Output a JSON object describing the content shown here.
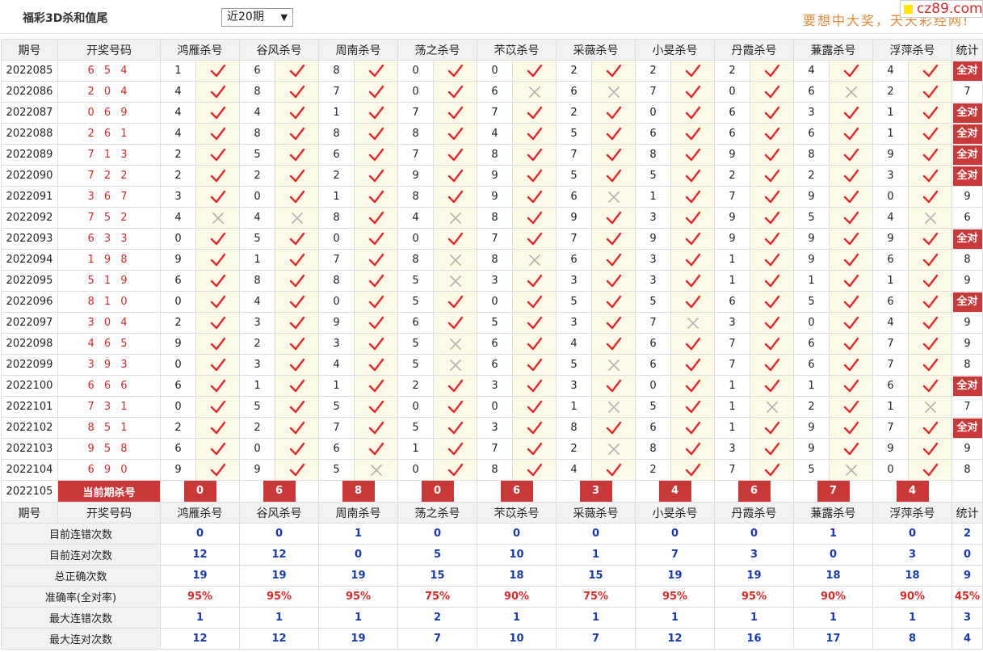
{
  "header": {
    "title": "福彩3D杀和值尾",
    "range_select": "近20期",
    "slogan": "要想中大奖，天天彩经网!",
    "logo_text": "cz89.com"
  },
  "columns": [
    "期号",
    "开奖号码",
    "鸿雁杀号",
    "谷风杀号",
    "周南杀号",
    "荡之杀号",
    "芣苡杀号",
    "采薇杀号",
    "小旻杀号",
    "丹霞杀号",
    "蒹露杀号",
    "浮萍杀号",
    "统计"
  ],
  "rows": [
    {
      "period": "2022085",
      "draw": "6 5 4",
      "kills": [
        [
          "1",
          "y"
        ],
        [
          "6",
          "y"
        ],
        [
          "8",
          "y"
        ],
        [
          "0",
          "y"
        ],
        [
          "0",
          "y"
        ],
        [
          "2",
          "y"
        ],
        [
          "2",
          "y"
        ],
        [
          "2",
          "y"
        ],
        [
          "4",
          "y"
        ],
        [
          "4",
          "y"
        ]
      ],
      "stat": "全对"
    },
    {
      "period": "2022086",
      "draw": "2 0 4",
      "kills": [
        [
          "4",
          "y"
        ],
        [
          "8",
          "y"
        ],
        [
          "7",
          "y"
        ],
        [
          "0",
          "y"
        ],
        [
          "6",
          "n"
        ],
        [
          "6",
          "n"
        ],
        [
          "7",
          "y"
        ],
        [
          "0",
          "y"
        ],
        [
          "6",
          "n"
        ],
        [
          "2",
          "y"
        ]
      ],
      "stat": "7"
    },
    {
      "period": "2022087",
      "draw": "0 6 9",
      "kills": [
        [
          "4",
          "y"
        ],
        [
          "4",
          "y"
        ],
        [
          "1",
          "y"
        ],
        [
          "7",
          "y"
        ],
        [
          "7",
          "y"
        ],
        [
          "2",
          "y"
        ],
        [
          "0",
          "y"
        ],
        [
          "6",
          "y"
        ],
        [
          "3",
          "y"
        ],
        [
          "1",
          "y"
        ]
      ],
      "stat": "全对"
    },
    {
      "period": "2022088",
      "draw": "2 6 1",
      "kills": [
        [
          "4",
          "y"
        ],
        [
          "8",
          "y"
        ],
        [
          "8",
          "y"
        ],
        [
          "8",
          "y"
        ],
        [
          "4",
          "y"
        ],
        [
          "5",
          "y"
        ],
        [
          "6",
          "y"
        ],
        [
          "6",
          "y"
        ],
        [
          "6",
          "y"
        ],
        [
          "1",
          "y"
        ]
      ],
      "stat": "全对"
    },
    {
      "period": "2022089",
      "draw": "7 1 3",
      "kills": [
        [
          "2",
          "y"
        ],
        [
          "5",
          "y"
        ],
        [
          "6",
          "y"
        ],
        [
          "7",
          "y"
        ],
        [
          "8",
          "y"
        ],
        [
          "7",
          "y"
        ],
        [
          "8",
          "y"
        ],
        [
          "9",
          "y"
        ],
        [
          "8",
          "y"
        ],
        [
          "9",
          "y"
        ]
      ],
      "stat": "全对"
    },
    {
      "period": "2022090",
      "draw": "7 2 2",
      "kills": [
        [
          "2",
          "y"
        ],
        [
          "2",
          "y"
        ],
        [
          "2",
          "y"
        ],
        [
          "9",
          "y"
        ],
        [
          "9",
          "y"
        ],
        [
          "5",
          "y"
        ],
        [
          "5",
          "y"
        ],
        [
          "2",
          "y"
        ],
        [
          "2",
          "y"
        ],
        [
          "3",
          "y"
        ]
      ],
      "stat": "全对"
    },
    {
      "period": "2022091",
      "draw": "3 6 7",
      "kills": [
        [
          "3",
          "y"
        ],
        [
          "0",
          "y"
        ],
        [
          "1",
          "y"
        ],
        [
          "8",
          "y"
        ],
        [
          "9",
          "y"
        ],
        [
          "6",
          "n"
        ],
        [
          "1",
          "y"
        ],
        [
          "7",
          "y"
        ],
        [
          "9",
          "y"
        ],
        [
          "0",
          "y"
        ]
      ],
      "stat": "9"
    },
    {
      "period": "2022092",
      "draw": "7 5 2",
      "kills": [
        [
          "4",
          "n"
        ],
        [
          "4",
          "n"
        ],
        [
          "8",
          "y"
        ],
        [
          "4",
          "n"
        ],
        [
          "8",
          "y"
        ],
        [
          "9",
          "y"
        ],
        [
          "3",
          "y"
        ],
        [
          "9",
          "y"
        ],
        [
          "5",
          "y"
        ],
        [
          "4",
          "n"
        ]
      ],
      "stat": "6"
    },
    {
      "period": "2022093",
      "draw": "6 3 3",
      "kills": [
        [
          "0",
          "y"
        ],
        [
          "5",
          "y"
        ],
        [
          "0",
          "y"
        ],
        [
          "0",
          "y"
        ],
        [
          "7",
          "y"
        ],
        [
          "7",
          "y"
        ],
        [
          "9",
          "y"
        ],
        [
          "9",
          "y"
        ],
        [
          "9",
          "y"
        ],
        [
          "9",
          "y"
        ]
      ],
      "stat": "全对"
    },
    {
      "period": "2022094",
      "draw": "1 9 8",
      "kills": [
        [
          "9",
          "y"
        ],
        [
          "1",
          "y"
        ],
        [
          "7",
          "y"
        ],
        [
          "8",
          "n"
        ],
        [
          "8",
          "n"
        ],
        [
          "6",
          "y"
        ],
        [
          "3",
          "y"
        ],
        [
          "1",
          "y"
        ],
        [
          "9",
          "y"
        ],
        [
          "6",
          "y"
        ]
      ],
      "stat": "8"
    },
    {
      "period": "2022095",
      "draw": "5 1 9",
      "kills": [
        [
          "6",
          "y"
        ],
        [
          "8",
          "y"
        ],
        [
          "8",
          "y"
        ],
        [
          "5",
          "n"
        ],
        [
          "3",
          "y"
        ],
        [
          "3",
          "y"
        ],
        [
          "3",
          "y"
        ],
        [
          "1",
          "y"
        ],
        [
          "1",
          "y"
        ],
        [
          "1",
          "y"
        ]
      ],
      "stat": "9"
    },
    {
      "period": "2022096",
      "draw": "8 1 0",
      "kills": [
        [
          "0",
          "y"
        ],
        [
          "4",
          "y"
        ],
        [
          "0",
          "y"
        ],
        [
          "5",
          "y"
        ],
        [
          "0",
          "y"
        ],
        [
          "5",
          "y"
        ],
        [
          "5",
          "y"
        ],
        [
          "6",
          "y"
        ],
        [
          "5",
          "y"
        ],
        [
          "6",
          "y"
        ]
      ],
      "stat": "全对"
    },
    {
      "period": "2022097",
      "draw": "3 0 4",
      "kills": [
        [
          "2",
          "y"
        ],
        [
          "3",
          "y"
        ],
        [
          "9",
          "y"
        ],
        [
          "6",
          "y"
        ],
        [
          "5",
          "y"
        ],
        [
          "3",
          "y"
        ],
        [
          "7",
          "n"
        ],
        [
          "3",
          "y"
        ],
        [
          "0",
          "y"
        ],
        [
          "4",
          "y"
        ]
      ],
      "stat": "9"
    },
    {
      "period": "2022098",
      "draw": "4 6 5",
      "kills": [
        [
          "9",
          "y"
        ],
        [
          "2",
          "y"
        ],
        [
          "3",
          "y"
        ],
        [
          "5",
          "n"
        ],
        [
          "6",
          "y"
        ],
        [
          "4",
          "y"
        ],
        [
          "6",
          "y"
        ],
        [
          "7",
          "y"
        ],
        [
          "6",
          "y"
        ],
        [
          "7",
          "y"
        ]
      ],
      "stat": "9"
    },
    {
      "period": "2022099",
      "draw": "3 9 3",
      "kills": [
        [
          "0",
          "y"
        ],
        [
          "3",
          "y"
        ],
        [
          "4",
          "y"
        ],
        [
          "5",
          "n"
        ],
        [
          "6",
          "y"
        ],
        [
          "5",
          "n"
        ],
        [
          "6",
          "y"
        ],
        [
          "7",
          "y"
        ],
        [
          "6",
          "y"
        ],
        [
          "7",
          "y"
        ]
      ],
      "stat": "8"
    },
    {
      "period": "2022100",
      "draw": "6 6 6",
      "kills": [
        [
          "6",
          "y"
        ],
        [
          "1",
          "y"
        ],
        [
          "1",
          "y"
        ],
        [
          "2",
          "y"
        ],
        [
          "3",
          "y"
        ],
        [
          "3",
          "y"
        ],
        [
          "0",
          "y"
        ],
        [
          "1",
          "y"
        ],
        [
          "1",
          "y"
        ],
        [
          "6",
          "y"
        ]
      ],
      "stat": "全对"
    },
    {
      "period": "2022101",
      "draw": "7 3 1",
      "kills": [
        [
          "0",
          "y"
        ],
        [
          "5",
          "y"
        ],
        [
          "5",
          "y"
        ],
        [
          "0",
          "y"
        ],
        [
          "0",
          "y"
        ],
        [
          "1",
          "n"
        ],
        [
          "5",
          "y"
        ],
        [
          "1",
          "n"
        ],
        [
          "2",
          "y"
        ],
        [
          "1",
          "n"
        ]
      ],
      "stat": "7"
    },
    {
      "period": "2022102",
      "draw": "8 5 1",
      "kills": [
        [
          "2",
          "y"
        ],
        [
          "2",
          "y"
        ],
        [
          "7",
          "y"
        ],
        [
          "5",
          "y"
        ],
        [
          "3",
          "y"
        ],
        [
          "8",
          "y"
        ],
        [
          "6",
          "y"
        ],
        [
          "1",
          "y"
        ],
        [
          "9",
          "y"
        ],
        [
          "7",
          "y"
        ]
      ],
      "stat": "全对"
    },
    {
      "period": "2022103",
      "draw": "9 5 8",
      "kills": [
        [
          "6",
          "y"
        ],
        [
          "0",
          "y"
        ],
        [
          "6",
          "y"
        ],
        [
          "1",
          "y"
        ],
        [
          "7",
          "y"
        ],
        [
          "2",
          "n"
        ],
        [
          "8",
          "y"
        ],
        [
          "3",
          "y"
        ],
        [
          "9",
          "y"
        ],
        [
          "9",
          "y"
        ]
      ],
      "stat": "9"
    },
    {
      "period": "2022104",
      "draw": "6 9 0",
      "kills": [
        [
          "9",
          "y"
        ],
        [
          "9",
          "y"
        ],
        [
          "5",
          "n"
        ],
        [
          "0",
          "y"
        ],
        [
          "8",
          "y"
        ],
        [
          "4",
          "y"
        ],
        [
          "2",
          "y"
        ],
        [
          "7",
          "y"
        ],
        [
          "5",
          "n"
        ],
        [
          "0",
          "y"
        ]
      ],
      "stat": "8"
    }
  ],
  "current": {
    "period": "2022105",
    "label": "当前期杀号",
    "preds": [
      "0",
      "6",
      "8",
      "0",
      "6",
      "3",
      "4",
      "6",
      "7",
      "4"
    ]
  },
  "summary": [
    {
      "label": "目前连错次数",
      "values": [
        "0",
        "0",
        "1",
        "0",
        "0",
        "0",
        "0",
        "0",
        "1",
        "0",
        "2"
      ],
      "red": false
    },
    {
      "label": "目前连对次数",
      "values": [
        "12",
        "12",
        "0",
        "5",
        "10",
        "1",
        "7",
        "3",
        "0",
        "3",
        "0"
      ],
      "red": false
    },
    {
      "label": "总正确次数",
      "values": [
        "19",
        "19",
        "19",
        "15",
        "18",
        "15",
        "19",
        "19",
        "18",
        "18",
        "9"
      ],
      "red": false
    },
    {
      "label": "准确率(全对率)",
      "values": [
        "95%",
        "95%",
        "95%",
        "75%",
        "90%",
        "75%",
        "95%",
        "95%",
        "90%",
        "90%",
        "45%"
      ],
      "red": true
    },
    {
      "label": "最大连错次数",
      "values": [
        "1",
        "1",
        "1",
        "2",
        "1",
        "1",
        "1",
        "1",
        "1",
        "1",
        "3"
      ],
      "red": false
    },
    {
      "label": "最大连对次数",
      "values": [
        "12",
        "12",
        "19",
        "7",
        "10",
        "7",
        "12",
        "16",
        "17",
        "8",
        "4"
      ],
      "red": false
    }
  ],
  "icons": {
    "correct": "check-icon",
    "wrong": "cross-icon"
  },
  "colors": {
    "accent_red": "#c83a3a",
    "check_red": "#e0282e",
    "cross_gray": "#b5b5b5",
    "summary_blue": "#1a3aa8"
  }
}
